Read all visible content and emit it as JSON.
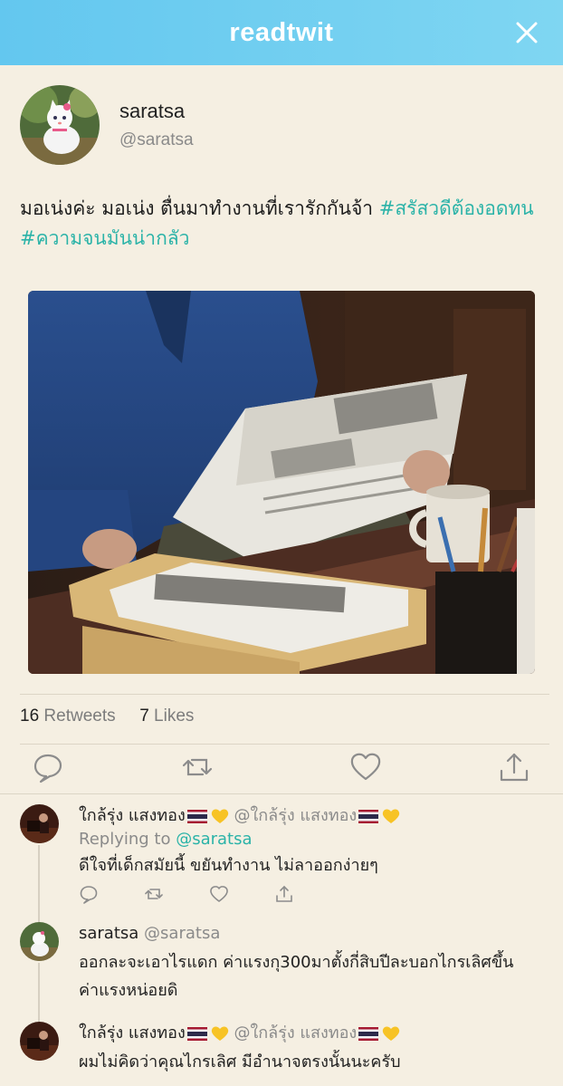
{
  "app": {
    "brand": "readtwit"
  },
  "tweet": {
    "author_name": "saratsa",
    "author_handle": "@saratsa",
    "text": "มอเน่งค่ะ มอเน่ง ตื่นมาทำงานที่เรารักกันจ้า ",
    "hashtags": [
      "#สรัสวดีต้องอดทน",
      "#ความจนมันน่ากลัว"
    ],
    "retweets_count": "16",
    "retweets_label": "Retweets",
    "likes_count": "7",
    "likes_label": "Likes"
  },
  "replies": [
    {
      "name": "ใกล้รุ่ง แสงทอง",
      "handle": "@ใกล้รุ่ง แสงทอง",
      "replying_label": "Replying to",
      "replying_to": "@saratsa",
      "text": "ดีใจที่เด็กสมัยนี้ ขยันทำงาน ไม่ลาออกง่ายๆ"
    },
    {
      "name": "saratsa",
      "handle": "@saratsa",
      "text_line1": "ออกละจะเอาไรแดก ค่าแรงกุ300มาตั้งกี่สิบปีละบอกไกรเลิศขึ้น",
      "text_line2": "ค่าแรงหน่อยดิ"
    },
    {
      "name": "ใกล้รุ่ง แสงทอง",
      "handle": "@ใกล้รุ่ง แสงทอง",
      "text": "ผมไม่คิดว่าคุณไกรเลิศ มีอำนาจตรงนั้นนะครับ"
    }
  ],
  "icons": {
    "close": "close-icon",
    "reply": "reply-icon",
    "retweet": "retweet-icon",
    "like": "heart-icon",
    "share": "share-icon"
  },
  "colors": {
    "header": "#63c7ef",
    "background": "#f5efe2",
    "hashtag": "#2bb3a8",
    "muted": "#8a8a8a"
  }
}
